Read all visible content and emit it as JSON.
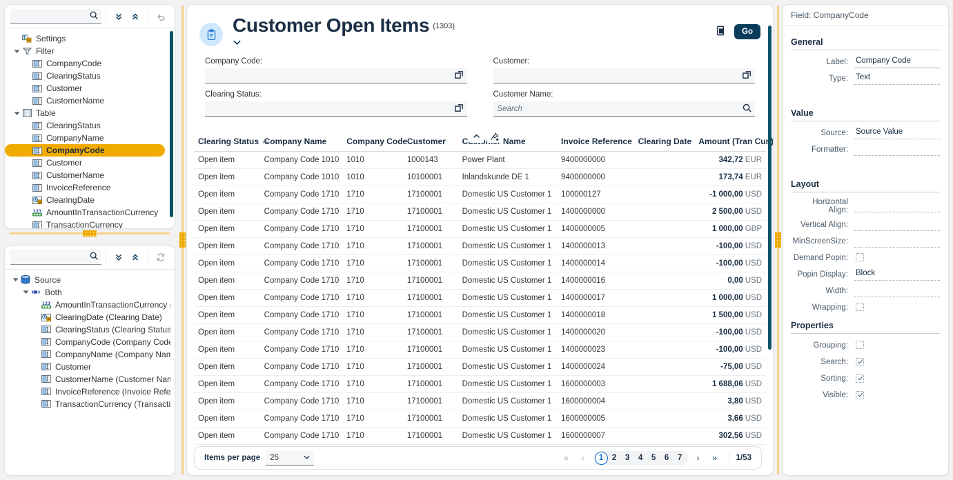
{
  "left_top": {
    "search": {
      "value": "",
      "placeholder": ""
    },
    "buttons": [
      {
        "name": "expand-all-button",
        "icon": "chevron-double-down-icon"
      },
      {
        "name": "collapse-all-button",
        "icon": "chevron-double-up-icon"
      },
      {
        "name": "undo-button",
        "icon": "undo-icon"
      }
    ],
    "tree": [
      {
        "label": "Settings",
        "icon": "settings-icon",
        "depth": 0,
        "twisty": "",
        "selected": false
      },
      {
        "label": "Filter",
        "icon": "filter-icon",
        "depth": 0,
        "twisty": "down",
        "selected": false
      },
      {
        "label": "CompanyCode",
        "icon": "text-field-icon",
        "depth": 1,
        "twisty": "",
        "selected": false
      },
      {
        "label": "ClearingStatus",
        "icon": "text-field-icon",
        "depth": 1,
        "twisty": "",
        "selected": false
      },
      {
        "label": "Customer",
        "icon": "text-field-icon",
        "depth": 1,
        "twisty": "",
        "selected": false
      },
      {
        "label": "CustomerName",
        "icon": "text-field-icon",
        "depth": 1,
        "twisty": "",
        "selected": false
      },
      {
        "label": "Table",
        "icon": "table-icon",
        "depth": 0,
        "twisty": "down",
        "selected": false
      },
      {
        "label": "ClearingStatus",
        "icon": "text-field-icon",
        "depth": 1,
        "twisty": "",
        "selected": false
      },
      {
        "label": "CompanyName",
        "icon": "text-field-icon",
        "depth": 1,
        "twisty": "",
        "selected": false
      },
      {
        "label": "CompanyCode",
        "icon": "text-field-icon",
        "depth": 1,
        "twisty": "",
        "selected": true
      },
      {
        "label": "Customer",
        "icon": "text-field-icon",
        "depth": 1,
        "twisty": "",
        "selected": false
      },
      {
        "label": "CustomerName",
        "icon": "text-field-icon",
        "depth": 1,
        "twisty": "",
        "selected": false
      },
      {
        "label": "InvoiceReference",
        "icon": "text-field-icon",
        "depth": 1,
        "twisty": "",
        "selected": false
      },
      {
        "label": "ClearingDate",
        "icon": "date-field-icon",
        "depth": 1,
        "twisty": "",
        "selected": false
      },
      {
        "label": "AmountInTransactionCurrency",
        "icon": "number-field-icon",
        "depth": 1,
        "twisty": "",
        "selected": false
      },
      {
        "label": "TransactionCurrency",
        "icon": "text-field-icon",
        "depth": 1,
        "twisty": "",
        "selected": false
      }
    ]
  },
  "left_bottom": {
    "search": {
      "value": "",
      "placeholder": ""
    },
    "buttons": [
      {
        "name": "expand-all-button",
        "icon": "chevron-double-down-icon"
      },
      {
        "name": "collapse-all-button",
        "icon": "chevron-double-up-icon"
      },
      {
        "name": "refresh-button",
        "icon": "refresh-icon"
      }
    ],
    "tree": [
      {
        "label": "Source",
        "icon": "database-icon",
        "depth": 0,
        "twisty": "down"
      },
      {
        "label": "Both",
        "icon": "binding-icon",
        "depth": 1,
        "twisty": "down"
      },
      {
        "label": "AmountInTransactionCurrency (Amo",
        "icon": "number-field-icon",
        "depth": 2,
        "twisty": ""
      },
      {
        "label": "ClearingDate (Clearing Date)",
        "icon": "date-field-icon",
        "depth": 2,
        "twisty": ""
      },
      {
        "label": "ClearingStatus (Clearing Status)",
        "icon": "text-field-icon",
        "depth": 2,
        "twisty": ""
      },
      {
        "label": "CompanyCode (Company Code)",
        "icon": "text-field-icon",
        "depth": 2,
        "twisty": ""
      },
      {
        "label": "CompanyName (Company Name)",
        "icon": "text-field-icon",
        "depth": 2,
        "twisty": ""
      },
      {
        "label": "Customer",
        "icon": "text-field-icon",
        "depth": 2,
        "twisty": ""
      },
      {
        "label": "CustomerName (Customer Name)",
        "icon": "text-field-icon",
        "depth": 2,
        "twisty": ""
      },
      {
        "label": "InvoiceReference (Invoice Reference",
        "icon": "text-field-icon",
        "depth": 2,
        "twisty": ""
      },
      {
        "label": "TransactionCurrency (Transaction C",
        "icon": "text-field-icon",
        "depth": 2,
        "twisty": ""
      }
    ]
  },
  "main": {
    "title": "Customer Open Items",
    "count": "(1303)",
    "go_label": "Go",
    "filters": [
      {
        "label": "Company Code:",
        "value": "",
        "placeholder": "",
        "end_icon": "value-help-icon"
      },
      {
        "label": "Customer:",
        "value": "",
        "placeholder": "",
        "end_icon": "value-help-icon"
      },
      {
        "label": "Clearing Status:",
        "value": "",
        "placeholder": "",
        "end_icon": "value-help-icon"
      },
      {
        "label": "Customer Name:",
        "value": "",
        "placeholder": "Search",
        "end_icon": "search-icon"
      }
    ],
    "table": {
      "columns": [
        {
          "label": "Clearing Status",
          "align": "left",
          "sorted": "asc",
          "width": "12%"
        },
        {
          "label": "Company Name",
          "align": "left",
          "sorted": "",
          "width": "15%"
        },
        {
          "label": "Company Code",
          "align": "left",
          "sorted": "",
          "width": "11%"
        },
        {
          "label": "Customer",
          "align": "left",
          "sorted": "",
          "width": "10%"
        },
        {
          "label": "Customer Name",
          "align": "left",
          "sorted": "",
          "width": "18%"
        },
        {
          "label": "Invoice Reference",
          "align": "left",
          "sorted": "",
          "width": "14%"
        },
        {
          "label": "Clearing Date",
          "align": "left",
          "sorted": "",
          "width": "11%"
        },
        {
          "label": "Amount (Tran Cur.)",
          "align": "right",
          "sorted": "",
          "width": "13%"
        }
      ],
      "rows": [
        {
          "status": "Open item",
          "company_name": "Company Code 1010",
          "company_code": "1010",
          "customer": "1000143",
          "customer_name": "Power Plant",
          "invoice_ref": "9400000000",
          "clearing_date": "",
          "amount": "342,72",
          "currency": "EUR"
        },
        {
          "status": "Open item",
          "company_name": "Company Code 1010",
          "company_code": "1010",
          "customer": "10100001",
          "customer_name": "Inlandskunde DE 1",
          "invoice_ref": "9400000000",
          "clearing_date": "",
          "amount": "173,74",
          "currency": "EUR"
        },
        {
          "status": "Open item",
          "company_name": "Company Code 1710",
          "company_code": "1710",
          "customer": "17100001",
          "customer_name": "Domestic US Customer 1",
          "invoice_ref": "100000127",
          "clearing_date": "",
          "amount": "-1 000,00",
          "currency": "USD"
        },
        {
          "status": "Open item",
          "company_name": "Company Code 1710",
          "company_code": "1710",
          "customer": "17100001",
          "customer_name": "Domestic US Customer 1",
          "invoice_ref": "1400000000",
          "clearing_date": "",
          "amount": "2 500,00",
          "currency": "USD"
        },
        {
          "status": "Open item",
          "company_name": "Company Code 1710",
          "company_code": "1710",
          "customer": "17100001",
          "customer_name": "Domestic US Customer 1",
          "invoice_ref": "1400000005",
          "clearing_date": "",
          "amount": "1 000,00",
          "currency": "GBP"
        },
        {
          "status": "Open item",
          "company_name": "Company Code 1710",
          "company_code": "1710",
          "customer": "17100001",
          "customer_name": "Domestic US Customer 1",
          "invoice_ref": "1400000013",
          "clearing_date": "",
          "amount": "-100,00",
          "currency": "USD"
        },
        {
          "status": "Open item",
          "company_name": "Company Code 1710",
          "company_code": "1710",
          "customer": "17100001",
          "customer_name": "Domestic US Customer 1",
          "invoice_ref": "1400000014",
          "clearing_date": "",
          "amount": "-100,00",
          "currency": "USD"
        },
        {
          "status": "Open item",
          "company_name": "Company Code 1710",
          "company_code": "1710",
          "customer": "17100001",
          "customer_name": "Domestic US Customer 1",
          "invoice_ref": "1400000016",
          "clearing_date": "",
          "amount": "0,00",
          "currency": "USD"
        },
        {
          "status": "Open item",
          "company_name": "Company Code 1710",
          "company_code": "1710",
          "customer": "17100001",
          "customer_name": "Domestic US Customer 1",
          "invoice_ref": "1400000017",
          "clearing_date": "",
          "amount": "1 000,00",
          "currency": "USD"
        },
        {
          "status": "Open item",
          "company_name": "Company Code 1710",
          "company_code": "1710",
          "customer": "17100001",
          "customer_name": "Domestic US Customer 1",
          "invoice_ref": "1400000018",
          "clearing_date": "",
          "amount": "1 500,00",
          "currency": "USD"
        },
        {
          "status": "Open item",
          "company_name": "Company Code 1710",
          "company_code": "1710",
          "customer": "17100001",
          "customer_name": "Domestic US Customer 1",
          "invoice_ref": "1400000020",
          "clearing_date": "",
          "amount": "-100,00",
          "currency": "USD"
        },
        {
          "status": "Open item",
          "company_name": "Company Code 1710",
          "company_code": "1710",
          "customer": "17100001",
          "customer_name": "Domestic US Customer 1",
          "invoice_ref": "1400000023",
          "clearing_date": "",
          "amount": "-100,00",
          "currency": "USD"
        },
        {
          "status": "Open item",
          "company_name": "Company Code 1710",
          "company_code": "1710",
          "customer": "17100001",
          "customer_name": "Domestic US Customer 1",
          "invoice_ref": "1400000024",
          "clearing_date": "",
          "amount": "-75,00",
          "currency": "USD"
        },
        {
          "status": "Open item",
          "company_name": "Company Code 1710",
          "company_code": "1710",
          "customer": "17100001",
          "customer_name": "Domestic US Customer 1",
          "invoice_ref": "1600000003",
          "clearing_date": "",
          "amount": "1 688,06",
          "currency": "USD"
        },
        {
          "status": "Open item",
          "company_name": "Company Code 1710",
          "company_code": "1710",
          "customer": "17100001",
          "customer_name": "Domestic US Customer 1",
          "invoice_ref": "1600000004",
          "clearing_date": "",
          "amount": "3,80",
          "currency": "USD"
        },
        {
          "status": "Open item",
          "company_name": "Company Code 1710",
          "company_code": "1710",
          "customer": "17100001",
          "customer_name": "Domestic US Customer 1",
          "invoice_ref": "1600000005",
          "clearing_date": "",
          "amount": "3,66",
          "currency": "USD"
        },
        {
          "status": "Open item",
          "company_name": "Company Code 1710",
          "company_code": "1710",
          "customer": "17100001",
          "customer_name": "Domestic US Customer 1",
          "invoice_ref": "1600000007",
          "clearing_date": "",
          "amount": "302,56",
          "currency": "USD"
        }
      ]
    },
    "pagination": {
      "items_per_page_label": "Items per page",
      "items_per_page_value": "25",
      "pages": [
        "1",
        "2",
        "3",
        "4",
        "5",
        "6",
        "7"
      ],
      "current_page": "1",
      "total_label": "1/53"
    }
  },
  "right": {
    "header": "Field: CompanyCode",
    "sections": [
      {
        "title": "General",
        "rows": [
          {
            "label": "Label:",
            "value": "Company Code",
            "kind": "text",
            "solid": true
          },
          {
            "label": "Type:",
            "value": "Text",
            "kind": "text",
            "solid": false
          }
        ]
      },
      {
        "title": "Value",
        "rows": [
          {
            "label": "Source:",
            "value": "Source Value",
            "kind": "text",
            "solid": false
          },
          {
            "label": "Formatter:",
            "value": "",
            "kind": "text",
            "solid": false
          }
        ]
      },
      {
        "title": "Layout",
        "rows": [
          {
            "label": "Horizontal Align:",
            "value": "",
            "kind": "text",
            "solid": false
          },
          {
            "label": "Vertical Align:",
            "value": "",
            "kind": "text",
            "solid": false
          },
          {
            "label": "MinScreenSize:",
            "value": "",
            "kind": "text",
            "solid": false
          },
          {
            "label": "Demand Popin:",
            "value": "",
            "kind": "checkbox",
            "checked": false
          },
          {
            "label": "Popin Display:",
            "value": "Block",
            "kind": "text",
            "solid": false
          },
          {
            "label": "Width:",
            "value": "",
            "kind": "text",
            "solid": false
          },
          {
            "label": "Wrapping:",
            "value": "",
            "kind": "checkbox",
            "checked": false
          }
        ]
      },
      {
        "title": "Properties",
        "rows": [
          {
            "label": "Grouping:",
            "value": "",
            "kind": "checkbox",
            "checked": false
          },
          {
            "label": "Search:",
            "value": "",
            "kind": "checkbox",
            "checked": true
          },
          {
            "label": "Sorting:",
            "value": "",
            "kind": "checkbox",
            "checked": true
          },
          {
            "label": "Visible:",
            "value": "",
            "kind": "checkbox",
            "checked": true
          }
        ]
      }
    ]
  },
  "colors": {
    "accent_orange": "#f0ab00",
    "dark_navy": "#0a3d5c",
    "scrollbar_teal": "#0d5368",
    "link_blue": "#0a6ed1",
    "icon_blue": "#2b7cd3"
  }
}
